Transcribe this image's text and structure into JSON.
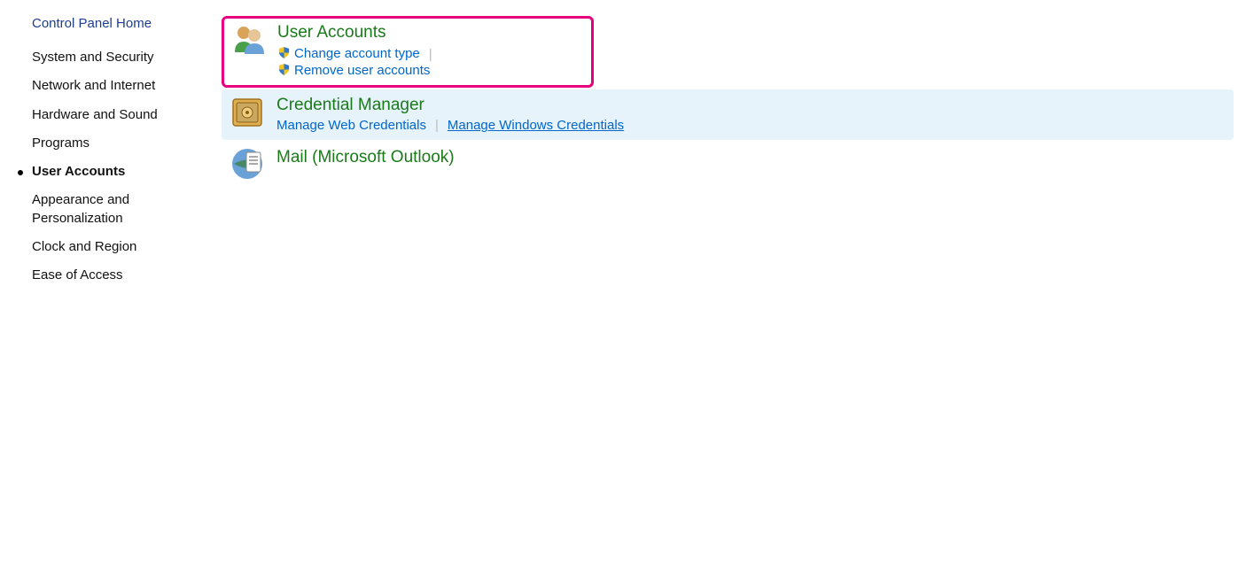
{
  "sidebar": {
    "heading": "Control Panel Home",
    "items": [
      {
        "label": "System and Security",
        "active": false
      },
      {
        "label": "Network and Internet",
        "active": false
      },
      {
        "label": "Hardware and Sound",
        "active": false
      },
      {
        "label": "Programs",
        "active": false
      },
      {
        "label": "User Accounts",
        "active": true
      },
      {
        "label": "Appearance and Personalization",
        "active": false
      },
      {
        "label": "Clock and Region",
        "active": false
      },
      {
        "label": "Ease of Access",
        "active": false
      }
    ]
  },
  "main": {
    "panels": [
      {
        "id": "user-accounts",
        "title": "User Accounts",
        "highlighted": true,
        "hovered": false,
        "icon": "users-icon",
        "links": [
          {
            "label": "Change account type",
            "shield": true,
            "hovered": false
          },
          {
            "label": "Remove user accounts",
            "shield": true,
            "hovered": false
          }
        ]
      },
      {
        "id": "credential-manager",
        "title": "Credential Manager",
        "highlighted": false,
        "hovered": true,
        "icon": "safe-icon",
        "links": [
          {
            "label": "Manage Web Credentials",
            "shield": false,
            "hovered": false
          },
          {
            "label": "Manage Windows Credentials",
            "shield": false,
            "hovered": true
          }
        ]
      },
      {
        "id": "mail-outlook",
        "title": "Mail (Microsoft Outlook)",
        "highlighted": false,
        "hovered": false,
        "icon": "mail-icon",
        "links": []
      }
    ]
  }
}
